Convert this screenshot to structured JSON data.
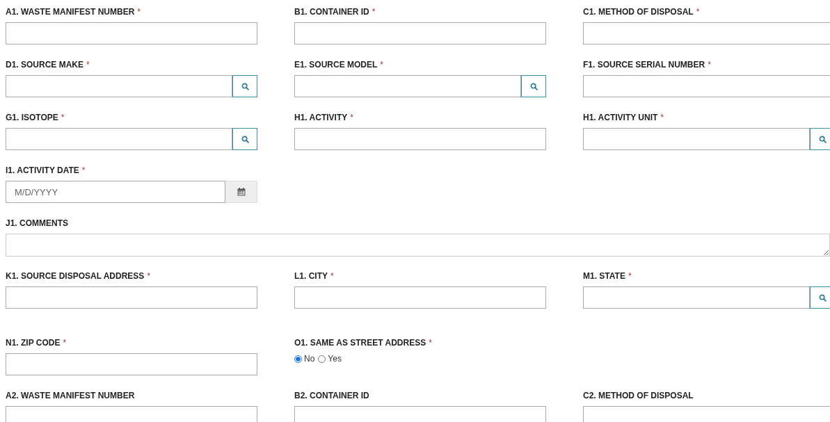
{
  "rows": [
    {
      "fields": [
        {
          "label": "A1. WASTE MANIFEST NUMBER",
          "marker": "*",
          "kind": "text"
        },
        {
          "label": "B1. CONTAINER ID",
          "marker": "*",
          "kind": "text"
        },
        {
          "label": "C1. METHOD OF DISPOSAL",
          "marker": "*",
          "kind": "text"
        }
      ]
    },
    {
      "fields": [
        {
          "label": "D1. SOURCE MAKE",
          "marker": "*",
          "kind": "lookup"
        },
        {
          "label": "E1. SOURCE MODEL",
          "marker": "*",
          "kind": "lookup"
        },
        {
          "label": "F1. SOURCE SERIAL NUMBER",
          "marker": "*",
          "kind": "text"
        }
      ]
    },
    {
      "fields": [
        {
          "label": "G1. ISOTOPE",
          "marker": "*",
          "kind": "lookup"
        },
        {
          "label": "H1. ACTIVITY",
          "marker": "*",
          "kind": "text"
        },
        {
          "label": "H1. ACTIVITY UNIT",
          "marker": "*",
          "kind": "lookup"
        }
      ]
    },
    {
      "fields": [
        {
          "label": "I1. ACTIVITY DATE",
          "marker": "*",
          "kind": "date",
          "placeholder": "M/D/YYYY"
        }
      ]
    },
    {
      "fields": [
        {
          "label": "J1. COMMENTS",
          "kind": "textarea"
        }
      ]
    },
    {
      "fields": [
        {
          "label": "K1. SOURCE DISPOSAL ADDRESS",
          "marker": "*",
          "kind": "text"
        },
        {
          "label": "L1. CITY",
          "marker": "*",
          "kind": "text"
        },
        {
          "label": "M1. STATE",
          "marker": "*",
          "kind": "lookup"
        }
      ]
    },
    {
      "fields": [
        {
          "label": "N1. ZIP CODE",
          "marker": "*",
          "kind": "text"
        },
        {
          "label": "O1. SAME AS STREET ADDRESS",
          "marker": "*",
          "kind": "radio",
          "options": [
            {
              "label": "No",
              "selected": true
            },
            {
              "label": "Yes",
              "selected": false
            }
          ]
        }
      ]
    },
    {
      "fields": [
        {
          "label": "A2. WASTE MANIFEST NUMBER",
          "kind": "text"
        },
        {
          "label": "B2. CONTAINER ID",
          "kind": "text"
        },
        {
          "label": "C2. METHOD OF DISPOSAL",
          "kind": "text"
        }
      ]
    }
  ]
}
